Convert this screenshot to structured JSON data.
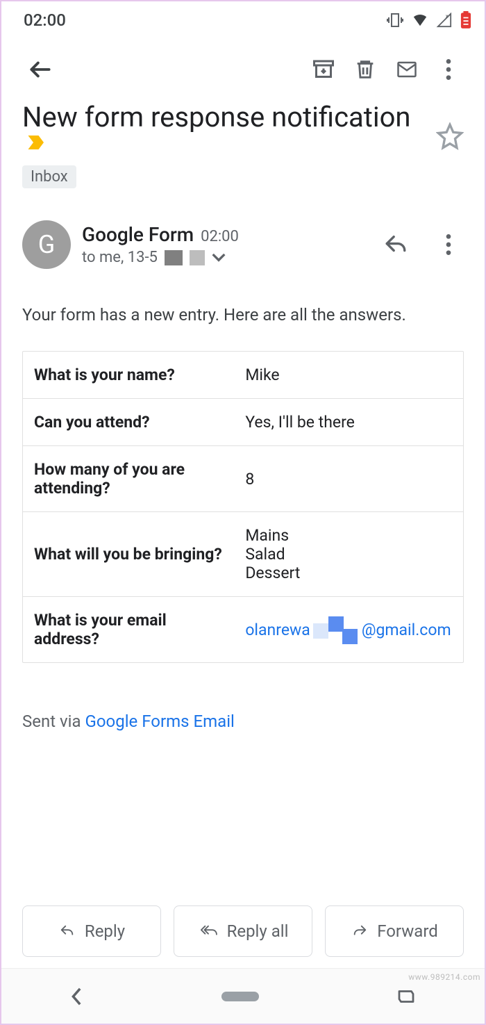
{
  "status": {
    "time": "02:00"
  },
  "subject": "New form response notification",
  "label": "Inbox",
  "sender": {
    "initial": "G",
    "name": "Google Form",
    "time": "02:00",
    "to_line": "to me, 13-5"
  },
  "body_intro": "Your form has a new entry. Here are all the answers.",
  "answers": [
    {
      "q": "What is your name?",
      "a": "Mike"
    },
    {
      "q": "Can you attend?",
      "a": "Yes, I'll be there"
    },
    {
      "q": "How many of you are attending?",
      "a": "8"
    },
    {
      "q": "What will you be bringing?",
      "a": "Mains\nSalad\nDessert"
    }
  ],
  "email_question": "What is your email address?",
  "email_answer_part1": "olanrewa",
  "email_answer_part2": "@gmail.com",
  "sent_via_prefix": "Sent via ",
  "sent_via_link": "Google Forms Email",
  "actions": {
    "reply": "Reply",
    "reply_all": "Reply all",
    "forward": "Forward"
  },
  "watermark": "www.989214.com"
}
